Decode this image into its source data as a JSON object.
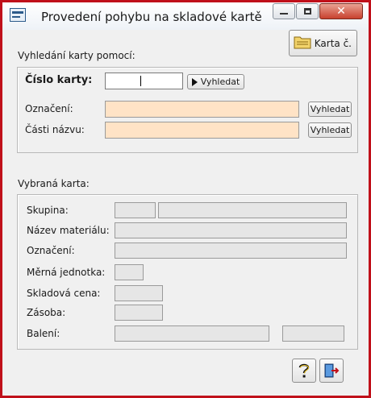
{
  "window": {
    "title": "Provedení pohybu na skladové kartě"
  },
  "toolbar": {
    "karta_button": "Karta č."
  },
  "search": {
    "section_label": "Vyhledání karty pomocí:",
    "cislo_label": "Číslo karty:",
    "cislo_value": "",
    "vyhledat_button": "Vyhledat",
    "oznaceni_label": "Označení:",
    "oznaceni_value": "",
    "oznaceni_button": "Vyhledat",
    "nazev_label": "Části názvu:",
    "nazev_value": "",
    "nazev_button": "Vyhledat"
  },
  "selected": {
    "section_label": "Vybraná karta:",
    "skupina_label": "Skupina:",
    "nazev_label": "Název materiálu:",
    "oznaceni_label": "Označení:",
    "jednotka_label": "Měrná jednotka:",
    "cena_label": "Skladová cena:",
    "zasoba_label": "Zásoba:",
    "baleni_label": "Balení:"
  },
  "footer": {
    "help_icon": "question-mark-icon",
    "exit_icon": "exit-door-icon"
  },
  "colors": {
    "frame": "#c0101a",
    "peach_input": "#ffe3c6",
    "readonly": "#e6e6e6"
  }
}
